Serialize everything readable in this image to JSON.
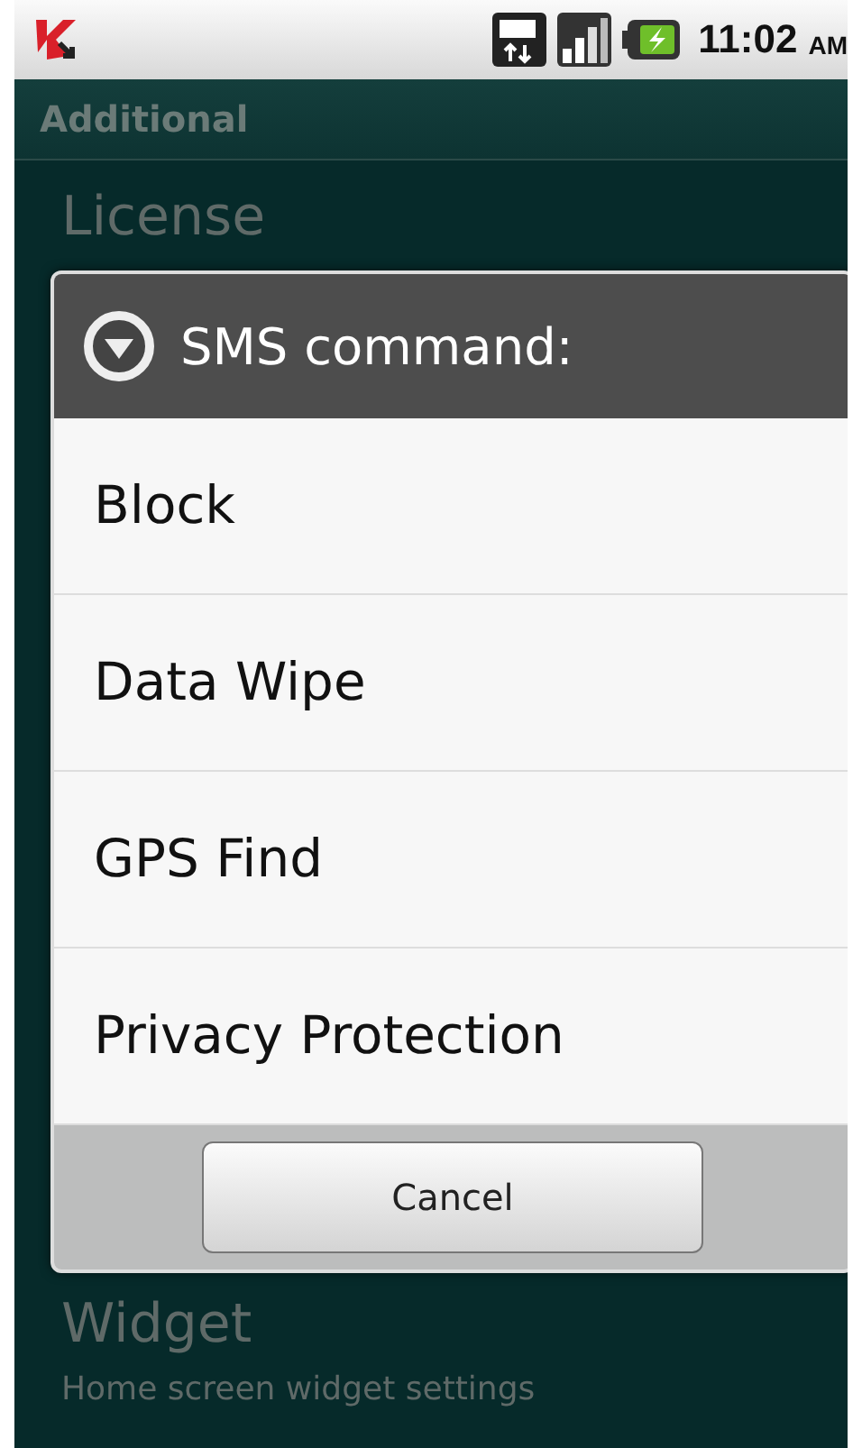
{
  "status_bar": {
    "time": "11:02",
    "ampm": "AM"
  },
  "header": "Additional",
  "settings": [
    {
      "title": "License"
    },
    {
      "title": "Widget",
      "subtitle": "Home screen widget settings"
    }
  ],
  "dialog": {
    "title": "SMS command:",
    "options": [
      {
        "label": "Block"
      },
      {
        "label": "Data Wipe"
      },
      {
        "label": "GPS Find"
      },
      {
        "label": "Privacy Protection"
      }
    ],
    "button": "Cancel"
  }
}
